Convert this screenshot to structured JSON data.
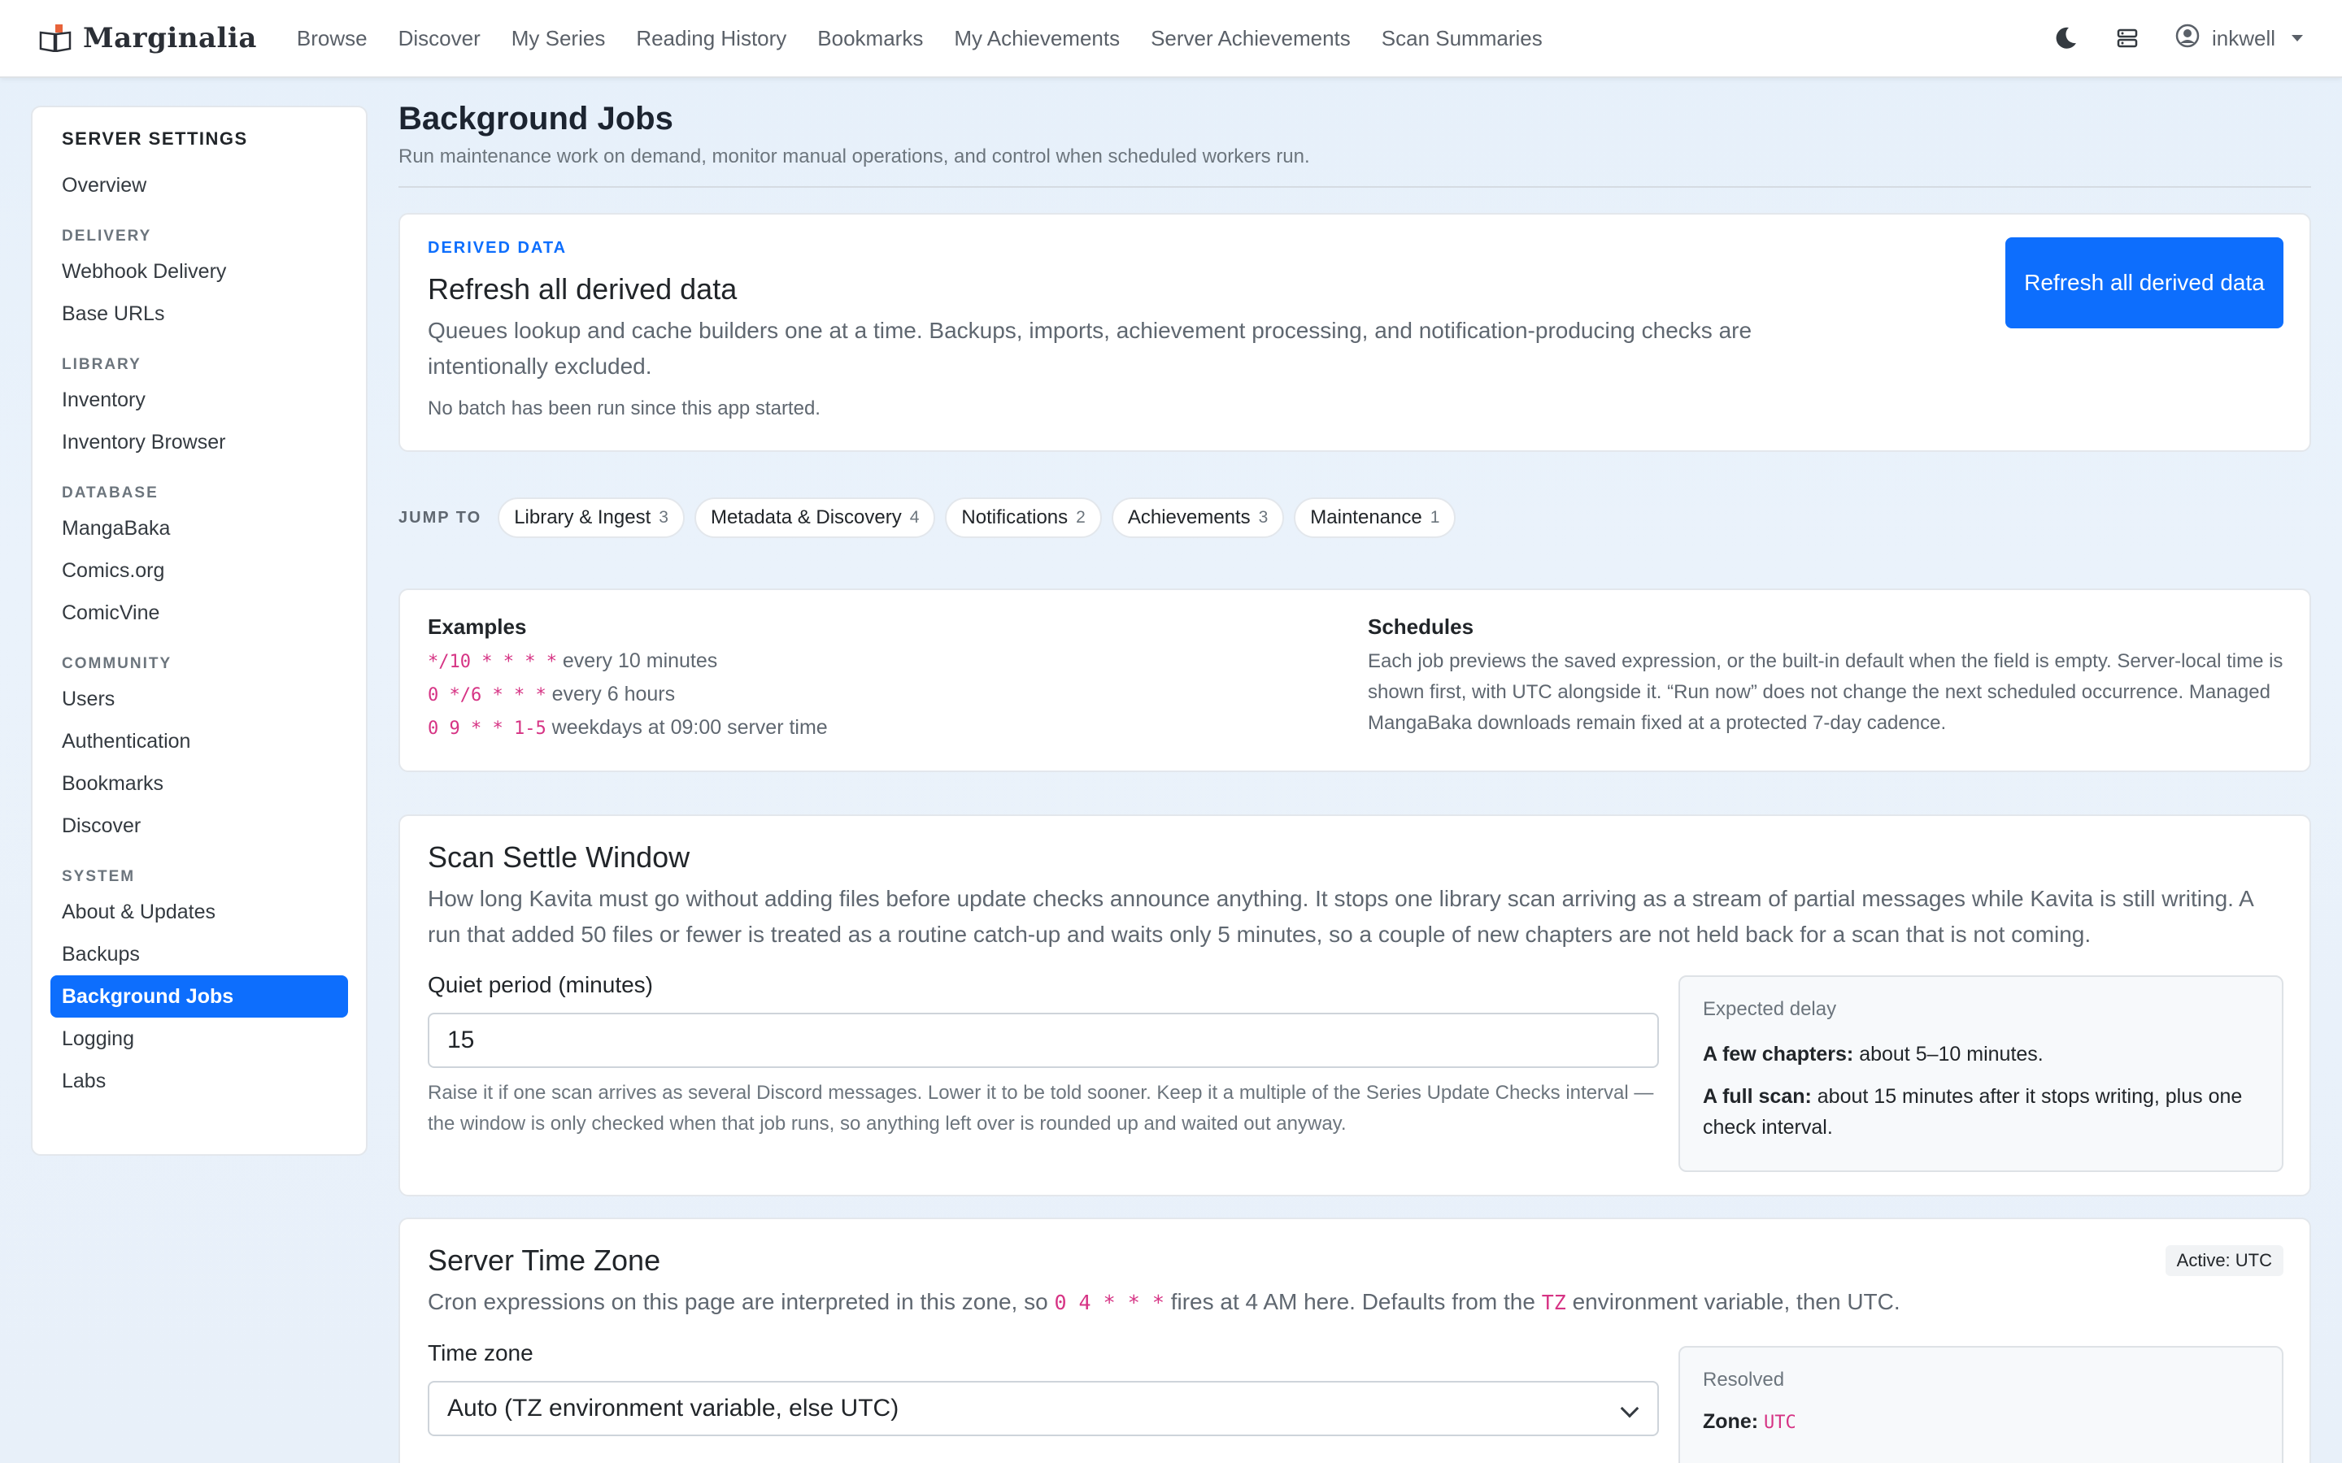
{
  "navbar": {
    "brand": "Marginalia",
    "links": [
      "Browse",
      "Discover",
      "My Series",
      "Reading History",
      "Bookmarks",
      "My Achievements",
      "Server Achievements",
      "Scan Summaries"
    ],
    "username": "inkwell"
  },
  "sidebar": {
    "title": "SERVER SETTINGS",
    "overview": "Overview",
    "sections": {
      "delivery": {
        "label": "DELIVERY",
        "items": [
          "Webhook Delivery",
          "Base URLs"
        ]
      },
      "library": {
        "label": "LIBRARY",
        "items": [
          "Inventory",
          "Inventory Browser"
        ]
      },
      "database": {
        "label": "DATABASE",
        "items": [
          "MangaBaka",
          "Comics.org",
          "ComicVine"
        ]
      },
      "community": {
        "label": "COMMUNITY",
        "items": [
          "Users",
          "Authentication",
          "Bookmarks",
          "Discover"
        ]
      },
      "system": {
        "label": "SYSTEM",
        "items": [
          "About & Updates",
          "Backups",
          "Background Jobs",
          "Logging",
          "Labs"
        ]
      }
    },
    "active_item": "Background Jobs"
  },
  "page": {
    "title": "Background Jobs",
    "subtitle": "Run maintenance work on demand, monitor manual operations, and control when scheduled workers run."
  },
  "derived": {
    "eyebrow": "DERIVED DATA",
    "heading": "Refresh all derived data",
    "description": "Queues lookup and cache builders one at a time. Backups, imports, achievement processing, and notification-producing checks are intentionally excluded.",
    "status": "No batch has been run since this app started.",
    "button": "Refresh all derived data"
  },
  "jump": {
    "label": "JUMP TO",
    "chips": [
      {
        "label": "Library & Ingest",
        "count": "3"
      },
      {
        "label": "Metadata & Discovery",
        "count": "4"
      },
      {
        "label": "Notifications",
        "count": "2"
      },
      {
        "label": "Achievements",
        "count": "3"
      },
      {
        "label": "Maintenance",
        "count": "1"
      }
    ]
  },
  "examples": {
    "heading": "Examples",
    "rows": [
      {
        "cron": "*/10 * * * *",
        "desc": "every 10 minutes"
      },
      {
        "cron": "0 */6 * * *",
        "desc": "every 6 hours"
      },
      {
        "cron": "0 9 * * 1-5",
        "desc": "weekdays at 09:00 server time"
      }
    ]
  },
  "schedules": {
    "heading": "Schedules",
    "text": "Each job previews the saved expression, or the built-in default when the field is empty. Server-local time is shown first, with UTC alongside it. “Run now” does not change the next scheduled occurrence. Managed MangaBaka downloads remain fixed at a protected 7-day cadence."
  },
  "settle": {
    "heading": "Scan Settle Window",
    "description": "How long Kavita must go without adding files before update checks announce anything. It stops one library scan arriving as a stream of partial messages while Kavita is still writing. A run that added 50 files or fewer is treated as a routine catch-up and waits only 5 minutes, so a couple of new chapters are not held back for a scan that is not coming.",
    "field_label": "Quiet period (minutes)",
    "value": "15",
    "help": "Raise it if one scan arrives as several Discord messages. Lower it to be told sooner. Keep it a multiple of the Series Update Checks interval — the window is only checked when that job runs, so anything left over is rounded up and waited out anyway.",
    "box": {
      "heading": "Expected delay",
      "few_label": "A few chapters:",
      "few_text": "about 5–10 minutes.",
      "full_label": "A full scan:",
      "full_text": "about 15 minutes after it stops writing, plus one check interval."
    }
  },
  "timezone": {
    "heading": "Server Time Zone",
    "badge": "Active: UTC",
    "desc_pre": "Cron expressions on this page are interpreted in this zone, so",
    "desc_code1": "0 4 * * *",
    "desc_mid": "fires at 4 AM here. Defaults from the",
    "desc_code2": "TZ",
    "desc_post": "environment variable, then UTC.",
    "field_label": "Time zone",
    "select_value": "Auto (TZ environment variable, else UTC)",
    "box": {
      "heading": "Resolved",
      "zone_label": "Zone:",
      "zone_value": "UTC"
    }
  }
}
